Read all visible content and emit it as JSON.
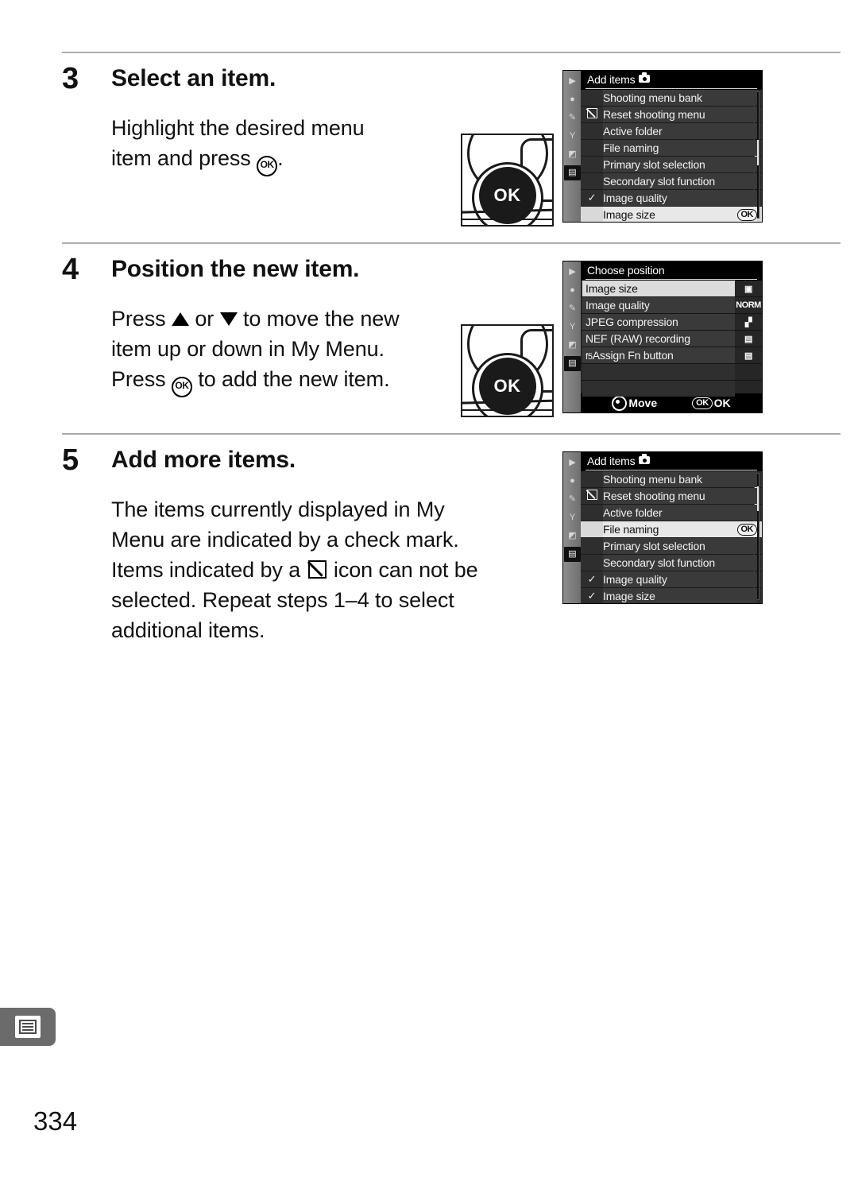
{
  "page": {
    "number": "334",
    "chapter_tab_icon": "menu-list-icon"
  },
  "steps": [
    {
      "number": "3",
      "title": "Select an item.",
      "body_line1": "Highlight the desired menu",
      "body_line2_pre": "item and press ",
      "body_line2_post": ".",
      "ok_glyph": "OK"
    },
    {
      "number": "4",
      "title": "Position the new item.",
      "l1_a": "Press ",
      "l1_b": " or ",
      "l1_c": " to move the new",
      "l2": "item up or down in My Menu.",
      "l3_a": "Press ",
      "l3_b": " to add the new item.",
      "ok_glyph": "OK"
    },
    {
      "number": "5",
      "title": "Add more items.",
      "l1": "The items currently displayed in My",
      "l2": "Menu are indicated by a check mark.",
      "l3_a": "Items indicated by a ",
      "l3_b": " icon can not be",
      "l4": "selected.  Repeat steps 1–4 to select",
      "l5": "additional items."
    }
  ],
  "camera_button": {
    "label": "OK",
    "name": "ok-button-illustration"
  },
  "rail_icons": [
    "playback-icon",
    "shooting-menu-icon",
    "custom-settings-icon",
    "setup-icon",
    "retouch-icon",
    "my-menu-icon"
  ],
  "screens": {
    "add_items_step3": {
      "title": "Add items",
      "title_icon": "camera-icon",
      "rows": [
        {
          "mark": "",
          "label": "Shooting menu bank",
          "selected": false,
          "ok": false
        },
        {
          "mark": "noselect",
          "label": "Reset shooting menu",
          "selected": false,
          "ok": false
        },
        {
          "mark": "",
          "label": "Active folder",
          "selected": false,
          "ok": false
        },
        {
          "mark": "",
          "label": "File naming",
          "selected": false,
          "ok": false
        },
        {
          "mark": "",
          "label": "Primary slot selection",
          "selected": false,
          "ok": false
        },
        {
          "mark": "",
          "label": "Secondary slot function",
          "selected": false,
          "ok": false
        },
        {
          "mark": "check",
          "label": "Image quality",
          "selected": false,
          "ok": false
        },
        {
          "mark": "",
          "label": "Image size",
          "selected": true,
          "ok": true,
          "ok_label": "OK"
        }
      ],
      "scroll": {
        "top_pct": 38,
        "height_pct": 20
      }
    },
    "choose_position_step4": {
      "title": "Choose position",
      "rows": [
        {
          "prefix": "",
          "label": "Image size",
          "icon": "image-size-icon",
          "selected": true
        },
        {
          "prefix": "",
          "label": "Image quality",
          "icon": "NORM",
          "selected": false
        },
        {
          "prefix": "",
          "label": "JPEG compression",
          "icon": "jpeg-compression-icon",
          "selected": false
        },
        {
          "prefix": "",
          "label": "NEF (RAW) recording",
          "icon": "nef-recording-icon",
          "selected": false
        },
        {
          "prefix": "f5",
          "label": "Assign Fn button",
          "icon": "assign-fn-icon",
          "selected": false
        },
        {
          "prefix": "",
          "label": "",
          "icon": "",
          "selected": false
        },
        {
          "prefix": "",
          "label": "",
          "icon": "",
          "selected": false
        }
      ],
      "footer": {
        "move_label": "Move",
        "ok_badge": "OK",
        "ok_label": "OK"
      }
    },
    "add_items_step5": {
      "title": "Add items",
      "title_icon": "camera-icon",
      "rows": [
        {
          "mark": "",
          "label": "Shooting menu bank",
          "selected": false,
          "ok": false
        },
        {
          "mark": "noselect",
          "label": "Reset shooting menu",
          "selected": false,
          "ok": false
        },
        {
          "mark": "",
          "label": "Active folder",
          "selected": false,
          "ok": false
        },
        {
          "mark": "",
          "label": "File naming",
          "selected": true,
          "ok": true,
          "ok_label": "OK"
        },
        {
          "mark": "",
          "label": "Primary slot selection",
          "selected": false,
          "ok": false
        },
        {
          "mark": "",
          "label": "Secondary slot function",
          "selected": false,
          "ok": false
        },
        {
          "mark": "check",
          "label": "Image quality",
          "selected": false,
          "ok": false
        },
        {
          "mark": "check",
          "label": "Image size",
          "selected": false,
          "ok": false
        }
      ],
      "scroll": {
        "top_pct": 10,
        "height_pct": 20
      }
    }
  }
}
